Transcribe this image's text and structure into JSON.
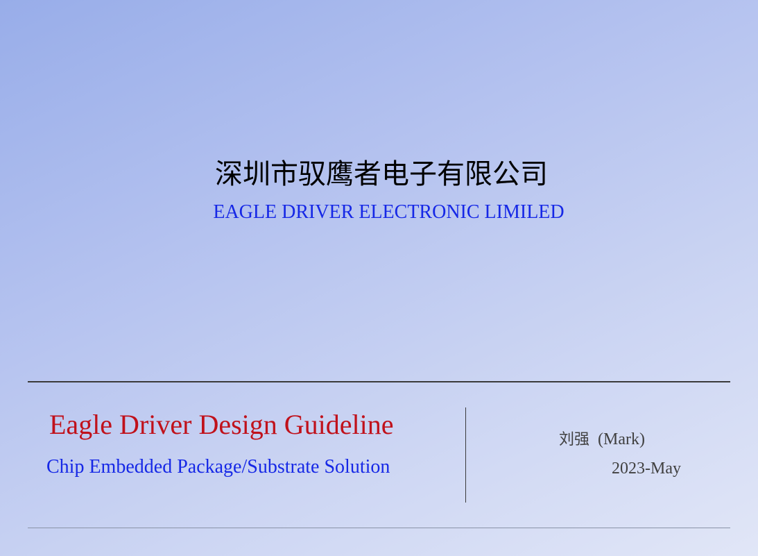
{
  "header": {
    "company_cn": "深圳市驭鹰者电子有限公司",
    "company_en": "EAGLE DRIVER ELECTRONIC LIMILED"
  },
  "document": {
    "title": "Eagle Driver Design Guideline",
    "subtitle": "Chip Embedded Package/Substrate Solution"
  },
  "meta": {
    "author_cn": "刘强",
    "author_en": "(Mark)",
    "date": "2023-May"
  },
  "colors": {
    "title_red": "#c0111b",
    "accent_blue": "#1628e6",
    "text_gray": "#404040"
  }
}
